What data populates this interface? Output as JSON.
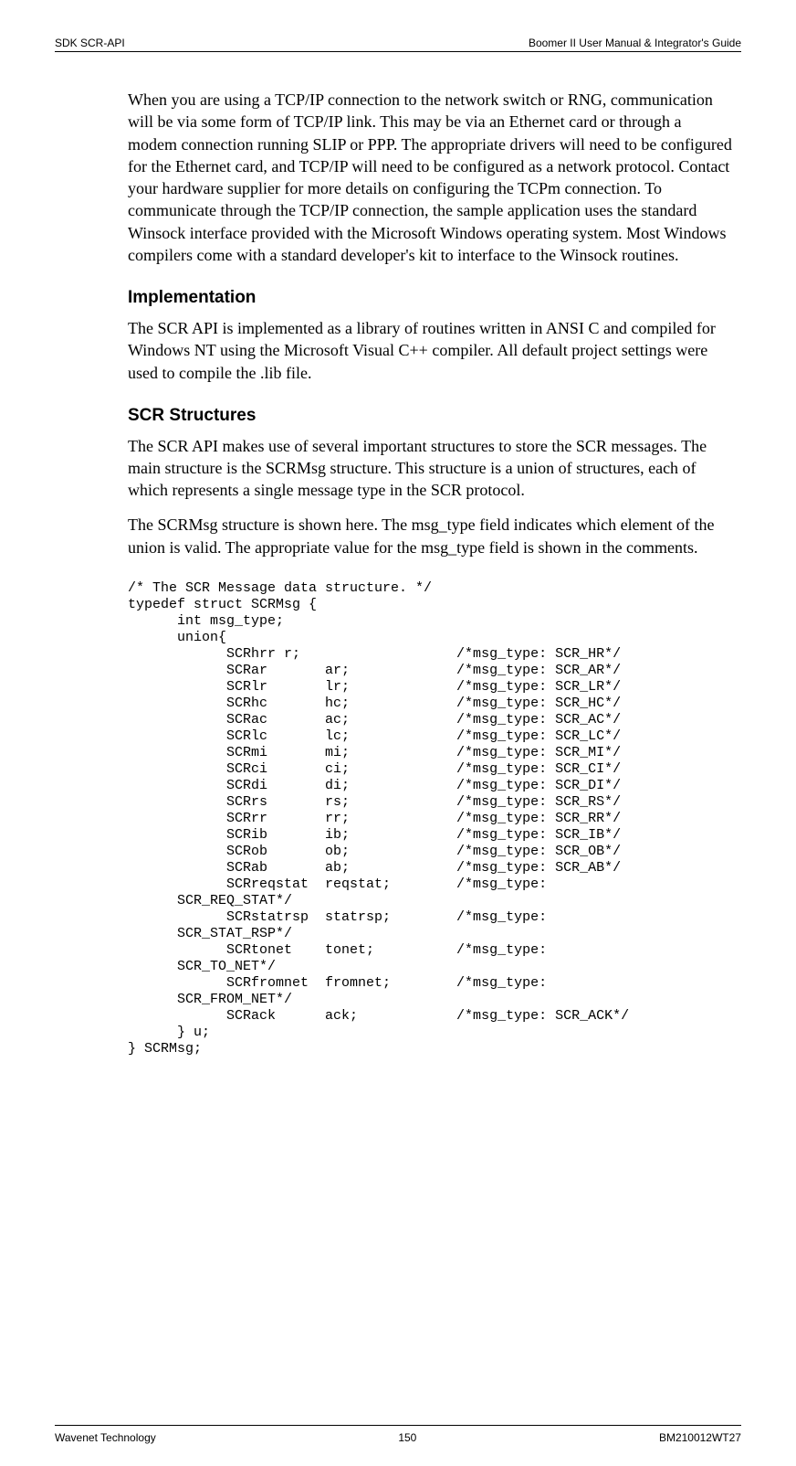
{
  "header": {
    "left": "SDK SCR-API",
    "right": "Boomer II User Manual & Integrator's Guide"
  },
  "body": {
    "para1": "When you are using a TCP/IP connection to the network switch or RNG, communication will be via some form of TCP/IP link. This may be via an Ethernet card or through a modem connection running SLIP or PPP. The appropriate drivers will need to be configured for the Ethernet card, and TCP/IP will need to be configured as a network protocol. Contact your hardware supplier for more details on configuring the TCPm connection. To communicate through the TCP/IP connection, the sample application uses the standard Winsock interface provided with the Microsoft Windows operating system. Most Windows compilers come with a standard developer's kit to interface to the Winsock routines.",
    "h_impl": "Implementation",
    "para2": "The SCR API is implemented as a library of routines written in ANSI C and compiled for Windows NT using the Microsoft Visual C++ compiler. All default project settings were used to compile the .lib file.",
    "h_struct": "SCR Structures",
    "para3": "The SCR API makes use of several important structures to store the SCR messages. The main structure is the SCRMsg structure. This structure is a union of structures, each of which represents a single message type in the SCR protocol.",
    "para4": "The SCRMsg structure is shown here. The msg_type field indicates which element of the union is valid. The appropriate value for the msg_type field is shown in the comments.",
    "code": "/* The SCR Message data structure. */\ntypedef struct SCRMsg {\n      int msg_type;\n      union{\n            SCRhrr r;                   /*msg_type: SCR_HR*/\n            SCRar       ar;             /*msg_type: SCR_AR*/\n            SCRlr       lr;             /*msg_type: SCR_LR*/\n            SCRhc       hc;             /*msg_type: SCR_HC*/\n            SCRac       ac;             /*msg_type: SCR_AC*/\n            SCRlc       lc;             /*msg_type: SCR_LC*/\n            SCRmi       mi;             /*msg_type: SCR_MI*/\n            SCRci       ci;             /*msg_type: SCR_CI*/\n            SCRdi       di;             /*msg_type: SCR_DI*/\n            SCRrs       rs;             /*msg_type: SCR_RS*/\n            SCRrr       rr;             /*msg_type: SCR_RR*/\n            SCRib       ib;             /*msg_type: SCR_IB*/\n            SCRob       ob;             /*msg_type: SCR_OB*/\n            SCRab       ab;             /*msg_type: SCR_AB*/\n            SCRreqstat  reqstat;        /*msg_type:\n      SCR_REQ_STAT*/\n            SCRstatrsp  statrsp;        /*msg_type:\n      SCR_STAT_RSP*/\n            SCRtonet    tonet;          /*msg_type:\n      SCR_TO_NET*/\n            SCRfromnet  fromnet;        /*msg_type:\n      SCR_FROM_NET*/\n            SCRack      ack;            /*msg_type: SCR_ACK*/\n      } u;\n} SCRMsg;"
  },
  "footer": {
    "left": "Wavenet Technology",
    "center": "150",
    "right": "BM210012WT27"
  }
}
